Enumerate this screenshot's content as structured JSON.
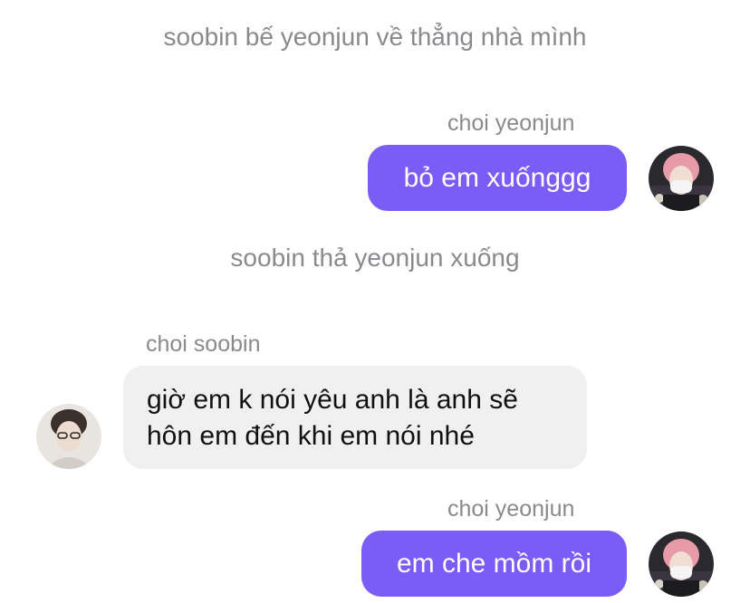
{
  "messages": {
    "system_1": "soobin bế yeonjun về thẳng nhà mình",
    "system_2": "soobin thả yeonjun xuống",
    "msg_1": {
      "sender": "choi yeonjun",
      "text": "bỏ em xuốnggg",
      "avatar_icon": "yeonjun-avatar-icon"
    },
    "msg_2": {
      "sender": "choi soobin",
      "text": "giờ em k nói yêu anh là anh sẽ hôn em đến khi em nói nhé",
      "avatar_icon": "soobin-avatar-icon"
    },
    "msg_3": {
      "sender": "choi yeonjun",
      "text": "em che mồm rồi",
      "avatar_icon": "yeonjun-avatar-icon"
    }
  },
  "colors": {
    "outgoing_bubble": "#7a5cf6",
    "incoming_bubble": "#f0f0f0",
    "meta_text": "#8a8a8e"
  }
}
